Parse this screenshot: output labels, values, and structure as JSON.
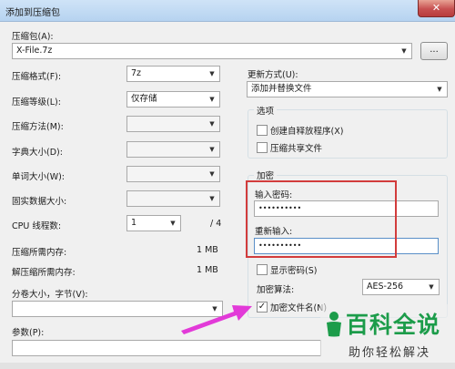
{
  "window": {
    "title": "添加到压缩包",
    "close_glyph": "✕"
  },
  "archive": {
    "label": "压缩包(A):",
    "value": "X-File.7z",
    "browse_label": "..."
  },
  "left": {
    "format": {
      "label": "压缩格式(F):",
      "value": "7z"
    },
    "level": {
      "label": "压缩等级(L):",
      "value": "仅存储"
    },
    "method": {
      "label": "压缩方法(M):",
      "value": ""
    },
    "dict": {
      "label": "字典大小(D):",
      "value": ""
    },
    "word": {
      "label": "单词大小(W):",
      "value": ""
    },
    "solid": {
      "label": "固实数据大小:",
      "value": ""
    },
    "threads": {
      "label": "CPU 线程数:",
      "value": "1",
      "total": "/ 4"
    },
    "mem_compress": {
      "label": "压缩所需内存:",
      "value": "1 MB"
    },
    "mem_decompress": {
      "label": "解压缩所需内存:",
      "value": "1 MB"
    },
    "split": {
      "label": "分卷大小，字节(V):",
      "value": ""
    },
    "params": {
      "label": "参数(P):",
      "value": ""
    }
  },
  "right": {
    "update": {
      "label": "更新方式(U):",
      "value": "添加并替换文件"
    },
    "options": {
      "title": "选项",
      "sfx": {
        "label": "创建自释放程序(X)",
        "checked": false
      },
      "shared": {
        "label": "压缩共享文件",
        "checked": false
      }
    },
    "encryption": {
      "title": "加密",
      "password_label": "输入密码:",
      "password_value": "••••••••••",
      "reenter_label": "重新输入:",
      "reenter_value": "••••••••••",
      "show_password": {
        "label": "显示密码(S)",
        "checked": false
      },
      "method_label": "加密算法:",
      "method_value": "AES-256",
      "encrypt_names": {
        "label": "加密文件名(N)",
        "checked": true,
        "mark": "✓"
      }
    }
  },
  "watermark": {
    "main": "百科全说",
    "sub": "助你轻松解决"
  },
  "colors": {
    "highlight": "#d23c3c",
    "arrow": "#e23ad8",
    "watermark": "#1c9c4a"
  },
  "icons": {
    "dropdown": "chevron-down-icon",
    "close": "close-icon",
    "check": "check-icon"
  }
}
